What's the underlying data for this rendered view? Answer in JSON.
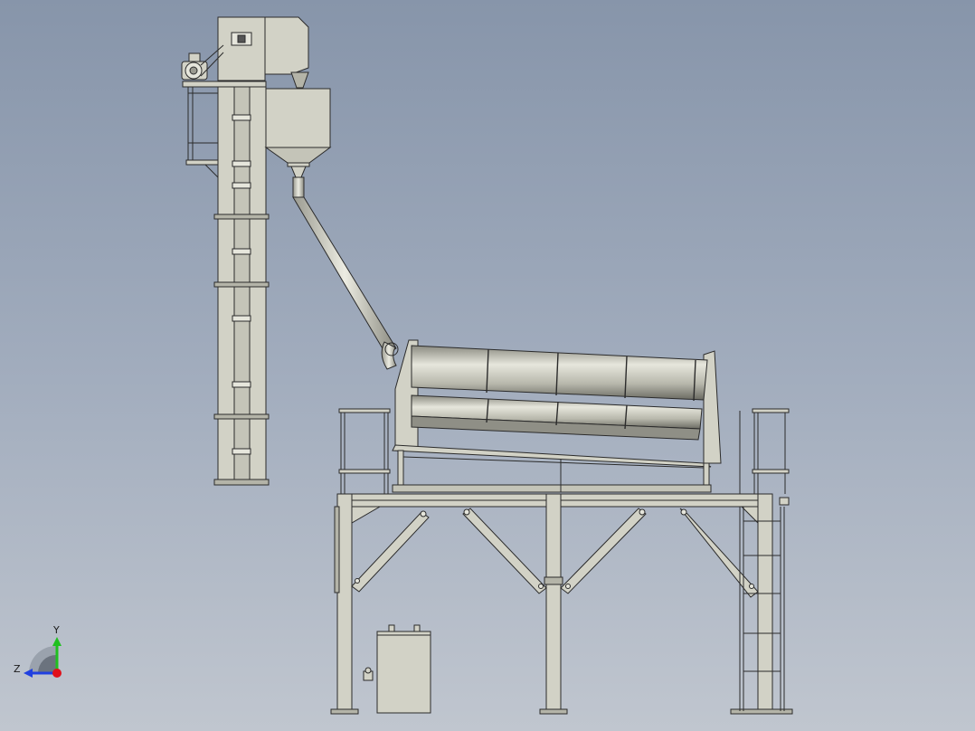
{
  "viewport": {
    "background_top": "#8795aa",
    "background_bottom": "#c0c6cf"
  },
  "colors": {
    "metal": "#d2d2c6",
    "metal_shade": "#b4b4a8",
    "edge": "#2b2b2b",
    "x_axis": "#e0101a",
    "y_axis": "#20c020",
    "z_axis": "#2040e0"
  },
  "axis_triad": {
    "y_label": "Y",
    "z_label": "Z"
  },
  "components": [
    {
      "name": "bucket-elevator",
      "icon": "bucket-elevator-icon"
    },
    {
      "name": "drive-motor",
      "icon": "motor-icon"
    },
    {
      "name": "discharge-hopper",
      "icon": "hopper-icon"
    },
    {
      "name": "feed-chute",
      "icon": "pipe-icon"
    },
    {
      "name": "trommel-drum",
      "icon": "rotary-drum-icon"
    },
    {
      "name": "support-platform",
      "icon": "steel-frame-icon"
    },
    {
      "name": "access-ladders",
      "icon": "ladder-icon"
    },
    {
      "name": "electrical-cabinet",
      "icon": "cabinet-icon"
    }
  ]
}
